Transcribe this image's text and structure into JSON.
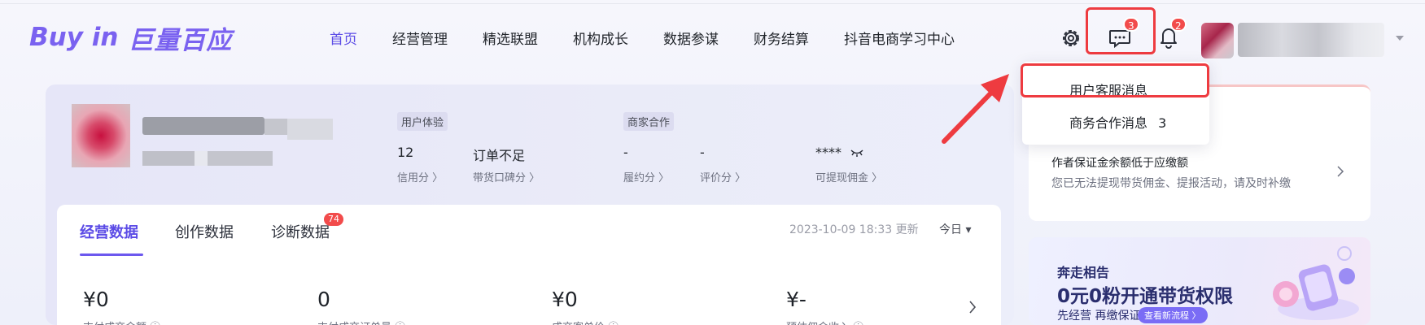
{
  "header": {
    "logo_en": "Buy in",
    "logo_cn": "巨量百应",
    "nav": [
      {
        "label": "首页",
        "active": true
      },
      {
        "label": "经营管理"
      },
      {
        "label": "精选联盟"
      },
      {
        "label": "机构成长"
      },
      {
        "label": "数据参谋"
      },
      {
        "label": "财务结算"
      },
      {
        "label": "抖音电商学习中心"
      }
    ],
    "icons": {
      "settings": "gear-icon",
      "messages": "message-icon",
      "notifications": "bell-icon",
      "account_menu": "chevron-down-icon"
    },
    "message_badge": "3",
    "notification_badge": "2"
  },
  "message_dropdown": {
    "items": [
      {
        "label": "用户客服消息"
      },
      {
        "label": "商务合作消息",
        "count": "3"
      }
    ]
  },
  "profile": {
    "user_experience_tag": "用户体验",
    "business_tag": "商家合作",
    "metrics": [
      {
        "value": "12",
        "label": "信用分 〉"
      },
      {
        "value": "订单不足",
        "label": "带货口碑分 〉"
      },
      {
        "value": "-",
        "label": "履约分 〉"
      },
      {
        "value": "-",
        "label": "评价分 〉"
      },
      {
        "value": "****",
        "label": "可提现佣金 〉"
      }
    ]
  },
  "notice": {
    "title": "作者保证金余额低于应缴额",
    "desc": "您已无法提现带货佣金、提报活动，请及时补缴"
  },
  "promo": {
    "line1": "奔走相告",
    "line2": "0元0粉开通带货权限",
    "line3": "先经营 再缴保证金",
    "button": "查看新流程 〉"
  },
  "data_panel": {
    "tabs": [
      {
        "label": "经营数据",
        "active": true
      },
      {
        "label": "创作数据"
      },
      {
        "label": "诊断数据",
        "badge": "74"
      }
    ],
    "updated": "2023-10-09 18:33 更新",
    "range": "今日 ▾",
    "kpis": [
      {
        "value": "¥0",
        "label": "支付成交金额 ⓘ"
      },
      {
        "value": "0",
        "label": "支付成交订单量 ⓘ"
      },
      {
        "value": "¥0",
        "label": "成交客单价 ⓘ"
      },
      {
        "value": "¥-",
        "label": "预估佣金收入 ⓘ"
      }
    ]
  },
  "colors": {
    "accent": "#5b4be6",
    "highlight": "#ee3b40",
    "badge": "#f24b4b"
  }
}
